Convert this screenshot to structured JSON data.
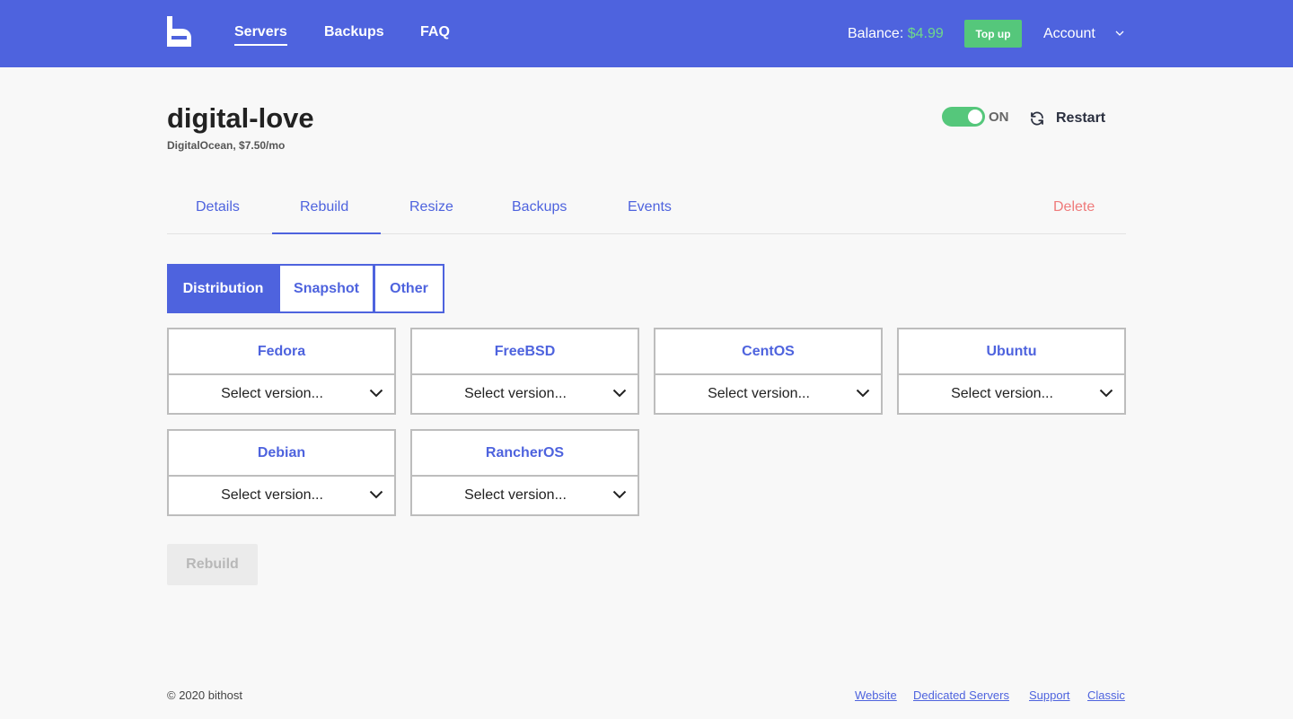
{
  "nav": {
    "links": [
      "Servers",
      "Backups",
      "FAQ"
    ],
    "balance_label": "Balance:",
    "balance_amount": "$4.99",
    "topup_label": "Top up",
    "account_label": "Account"
  },
  "server": {
    "name": "digital-love",
    "subtitle": "DigitalOcean, $7.50/mo",
    "power_state": "ON",
    "restart_label": "Restart"
  },
  "tabs": {
    "items": [
      "Details",
      "Rebuild",
      "Resize",
      "Backups",
      "Events"
    ],
    "active": "Rebuild",
    "delete_label": "Delete"
  },
  "source": {
    "options": [
      "Distribution",
      "Snapshot",
      "Other"
    ],
    "active": "Distribution"
  },
  "distributions": [
    {
      "name": "Fedora",
      "select_label": "Select version..."
    },
    {
      "name": "FreeBSD",
      "select_label": "Select version..."
    },
    {
      "name": "CentOS",
      "select_label": "Select version..."
    },
    {
      "name": "Ubuntu",
      "select_label": "Select version..."
    },
    {
      "name": "Debian",
      "select_label": "Select version..."
    },
    {
      "name": "RancherOS",
      "select_label": "Select version..."
    }
  ],
  "rebuild_button": "Rebuild",
  "footer": {
    "copyright": "© 2020 bithost",
    "links": [
      "Website",
      "Dedicated Servers",
      "Support",
      "Classic"
    ]
  },
  "colors": {
    "brand": "#4e63de",
    "success": "#55c77b",
    "danger": "#ef7b7b"
  },
  "icons": [
    "logo-icon",
    "chevron-down-icon",
    "refresh-icon"
  ]
}
